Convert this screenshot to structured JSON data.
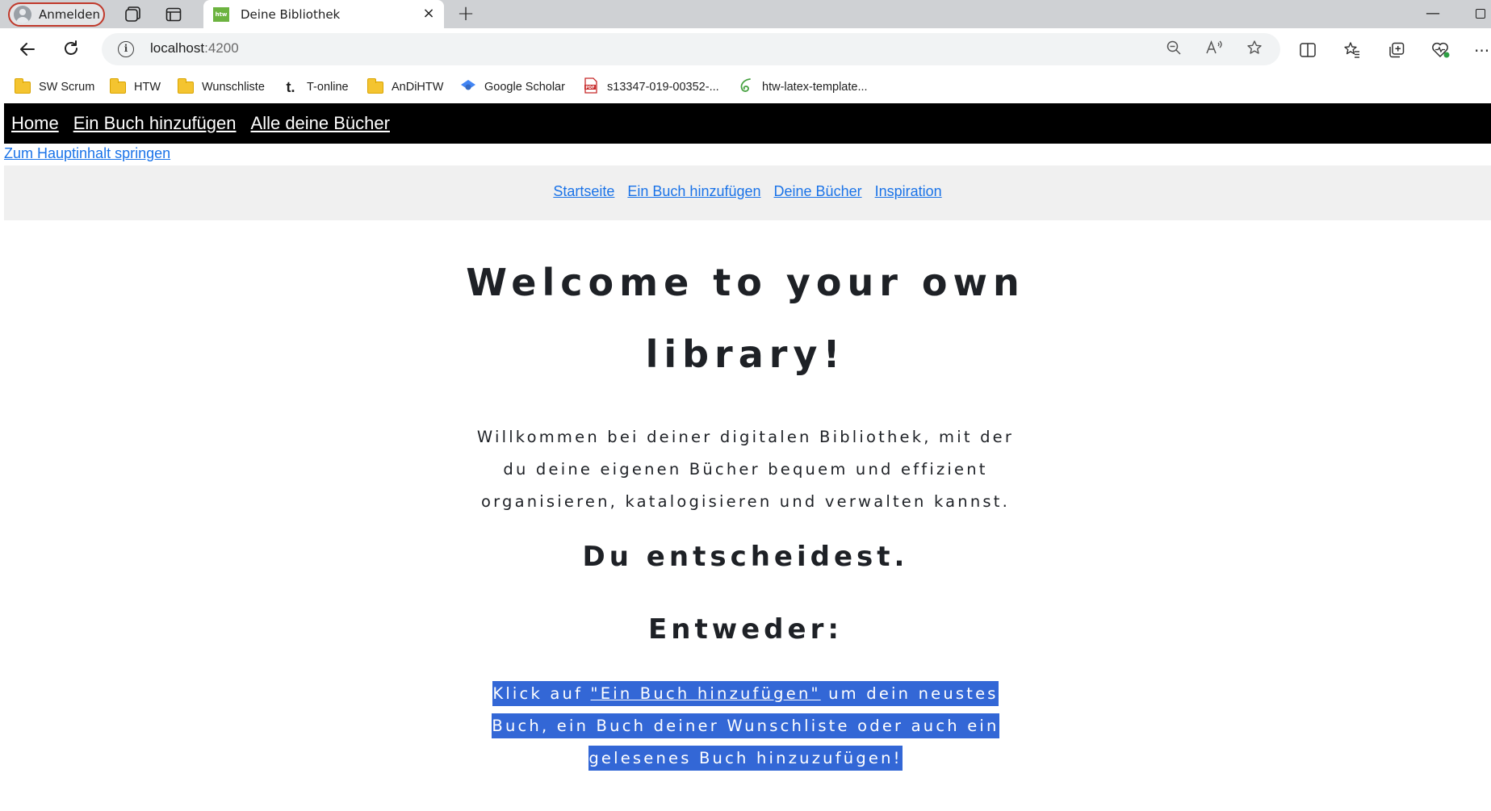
{
  "browser": {
    "profile_label": "Anmelden",
    "tab_title": "Deine Bibliothek",
    "favicon_text": "htw",
    "url_host": "localhost",
    "url_port": ":4200",
    "bookmarks": [
      {
        "label": "SW Scrum",
        "icon": "folder-icon"
      },
      {
        "label": "HTW",
        "icon": "folder-icon"
      },
      {
        "label": "Wunschliste",
        "icon": "folder-icon"
      },
      {
        "label": "T-online",
        "icon": "t-online-icon"
      },
      {
        "label": "AnDiHTW",
        "icon": "folder-icon"
      },
      {
        "label": "Google Scholar",
        "icon": "google-scholar-icon"
      },
      {
        "label": "s13347-019-00352-...",
        "icon": "pdf-icon"
      },
      {
        "label": "htw-latex-template...",
        "icon": "overleaf-icon"
      }
    ]
  },
  "app": {
    "topnav": [
      "Home",
      "Ein Buch hinzufügen",
      "Alle deine Bücher"
    ],
    "skip_link": "Zum Hauptinhalt springen",
    "subnav": [
      "Startseite",
      "Ein Buch hinzufügen",
      "Deine Bücher",
      "Inspiration"
    ],
    "hero_title": "Welcome to your own library!",
    "intro": "Willkommen bei deiner digitalen Bibliothek, mit der du deine eigenen Bücher bequem und effizient organisieren, katalogisieren und verwalten kannst.",
    "heading_decide": "Du entscheidest.",
    "heading_either": "Entweder:",
    "cta_prefix": "Klick auf ",
    "cta_link": "\"Ein Buch hinzufügen\"",
    "cta_suffix": " um dein neustes Buch, ein Buch deiner Wunschliste oder auch ein gelesenes Buch hinzuzufügen!"
  },
  "colors": {
    "link": "#1a73e8",
    "topnav_bg": "#000000",
    "selection": "#3367d6"
  }
}
